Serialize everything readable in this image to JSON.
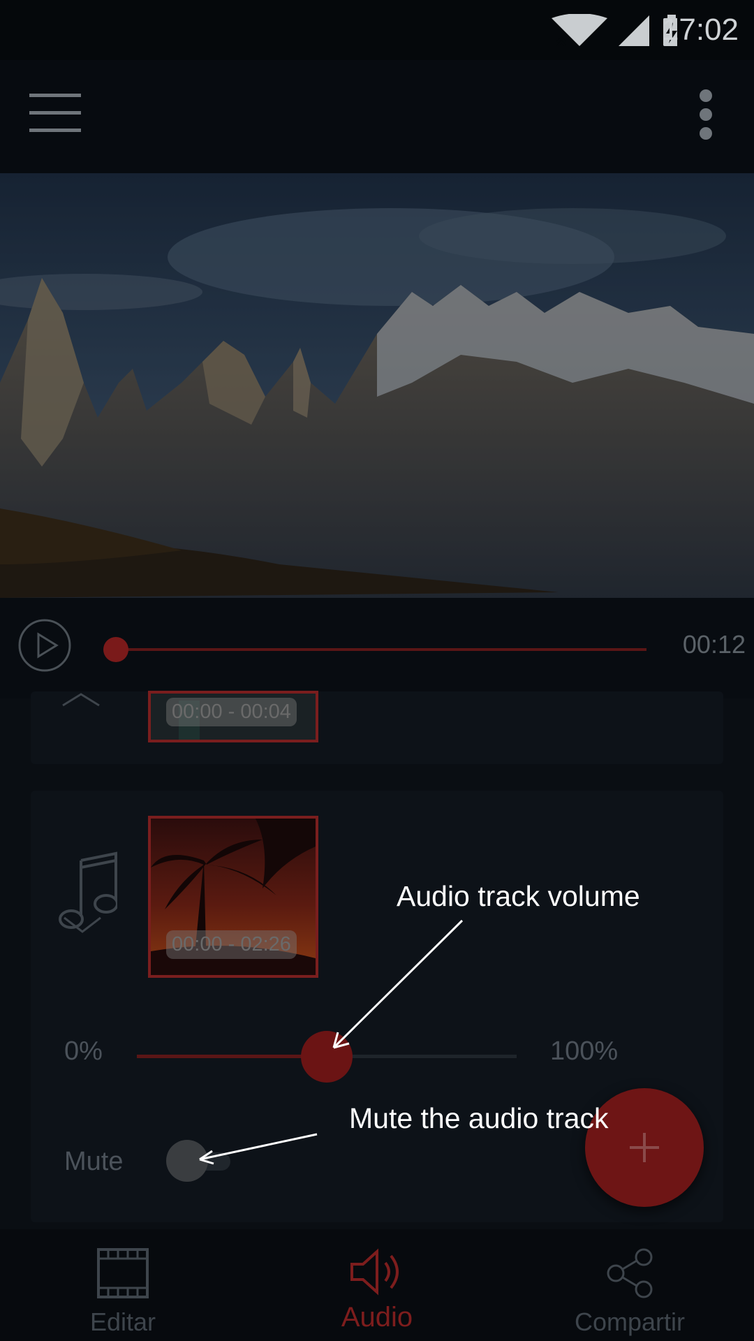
{
  "status_bar": {
    "time": "17:02"
  },
  "player": {
    "time": "00:12",
    "progress": 0.0
  },
  "tracks": {
    "video_clip": {
      "time_range": "00:00 - 00:04"
    },
    "audio_clip": {
      "time_range": "00:00 - 02:26"
    }
  },
  "volume": {
    "min_label": "0%",
    "max_label": "100%",
    "value_percent": 50
  },
  "mute": {
    "label": "Mute",
    "checked": false
  },
  "annotations": {
    "volume": "Audio track volume",
    "mute": "Mute the audio track"
  },
  "bottom_nav": [
    {
      "label": "Editar",
      "icon": "film-icon",
      "active": false
    },
    {
      "label": "Audio",
      "icon": "speaker-icon",
      "active": true
    },
    {
      "label": "Compartir",
      "icon": "share-icon",
      "active": false
    }
  ],
  "colors": {
    "accent": "#7a1e1e",
    "background": "#0a0e13"
  }
}
